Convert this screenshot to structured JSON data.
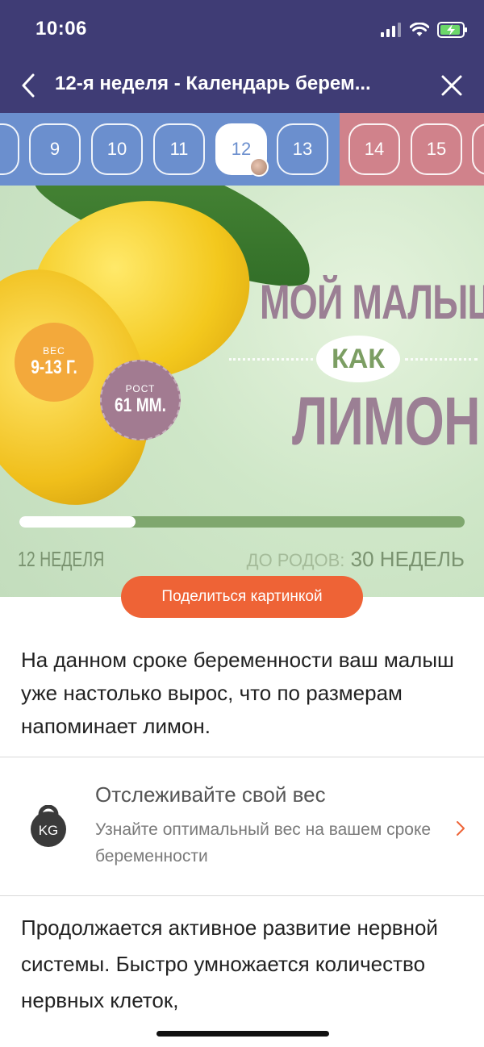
{
  "status": {
    "time": "10:06"
  },
  "nav": {
    "title": "12-я неделя - Календарь берем..."
  },
  "weeks": {
    "items": [
      "9",
      "10",
      "11",
      "12",
      "13",
      "14",
      "15"
    ],
    "active": "12"
  },
  "hero": {
    "weight_label": "ВЕС",
    "weight_value": "9-13 Г.",
    "height_label": "РОСТ",
    "height_value": "61 ММ.",
    "title_line1": "МОЙ МАЛЫШ",
    "title_kak": "КАК",
    "title_line2": "ЛИМОН",
    "progress_fraction": 0.26,
    "week_text": "12 НЕДЕЛЯ",
    "due_label": "ДО РОДОВ:",
    "due_value": "30 НЕДЕЛЬ"
  },
  "share_button": "Поделиться картинкой",
  "paragraph1": "На данном сроке беременности ваш малыш уже настолько вырос, что по размерам напоминает лимон.",
  "weight_card": {
    "icon": "kg-weight-icon",
    "icon_text": "KG",
    "title": "Отслеживайте свой вес",
    "subtitle": "Узнайте оптимальный вес на вашем сроке беременности"
  },
  "paragraph2": "Продолжается активное развитие нервной системы. Быстро умножается количество нервных клеток,",
  "colors": {
    "nav_bg": "#3f3c75",
    "week_blue": "#6b8fce",
    "week_pink": "#d0828b",
    "accent_orange": "#ee6336"
  }
}
